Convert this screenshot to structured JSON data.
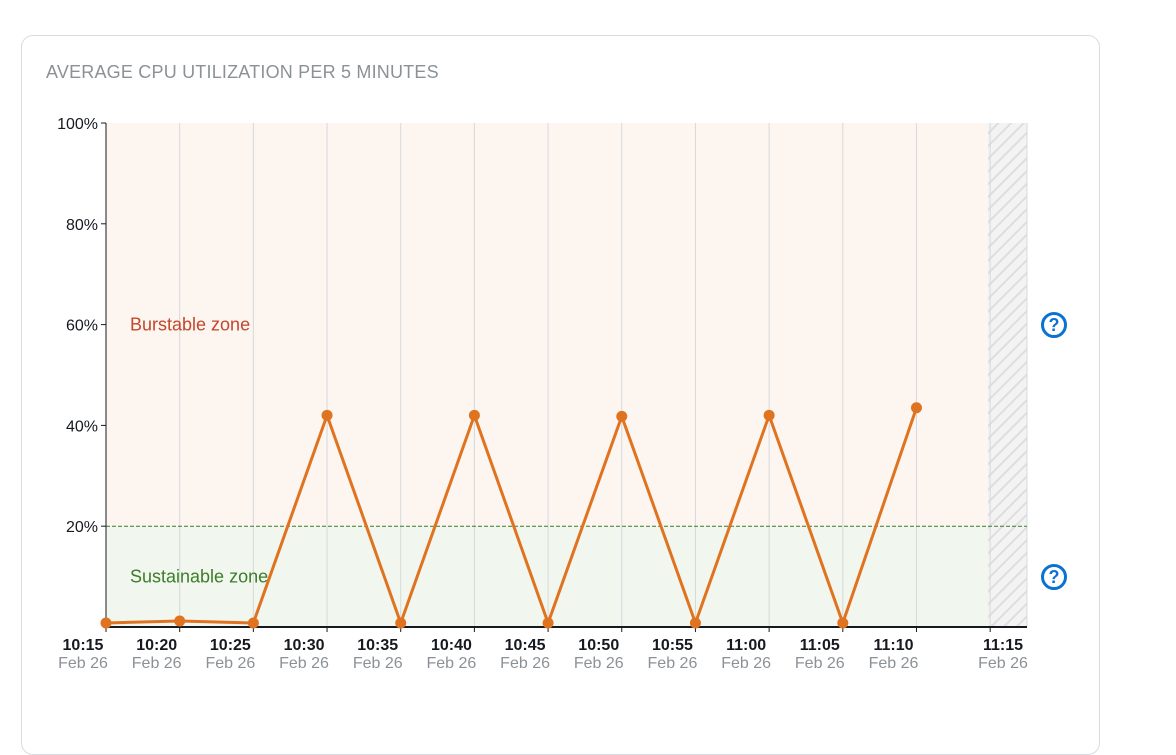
{
  "title": "AVERAGE CPU UTILIZATION PER 5 MINUTES",
  "zones": {
    "burstable": {
      "label": "Burstable zone",
      "color": "#c4462c",
      "fill": "#fcf5f0"
    },
    "sustainable": {
      "label": "Sustainable zone",
      "color": "#3d7d2a",
      "fill": "#f1f6ee"
    },
    "threshold": 20
  },
  "help_icons": {
    "burstable": "help-circle-icon",
    "sustainable": "help-circle-icon",
    "glyph": "?"
  },
  "chart_data": {
    "type": "line",
    "ylim": [
      0,
      100
    ],
    "ytick_labels": [
      "100%",
      "80%",
      "60%",
      "40%",
      "20%"
    ],
    "ytick_values": [
      100,
      80,
      60,
      40,
      20
    ],
    "x": [
      "10:15",
      "10:20",
      "10:25",
      "10:30",
      "10:35",
      "10:40",
      "10:45",
      "10:50",
      "10:55",
      "11:00",
      "11:05",
      "11:10",
      "11:15"
    ],
    "x_dates": [
      "Feb 26",
      "Feb 26",
      "Feb 26",
      "Feb 26",
      "Feb 26",
      "Feb 26",
      "Feb 26",
      "Feb 26",
      "Feb 26",
      "Feb 26",
      "Feb 26",
      "Feb 26",
      "Feb 26"
    ],
    "series": [
      {
        "color": "#e07320",
        "values": [
          0.8,
          1.2,
          0.8,
          42,
          0.8,
          42,
          0.8,
          41.8,
          0.8,
          42,
          0.8,
          43.5,
          null
        ]
      }
    ],
    "grid": true,
    "future_region": "hatched after last point"
  }
}
